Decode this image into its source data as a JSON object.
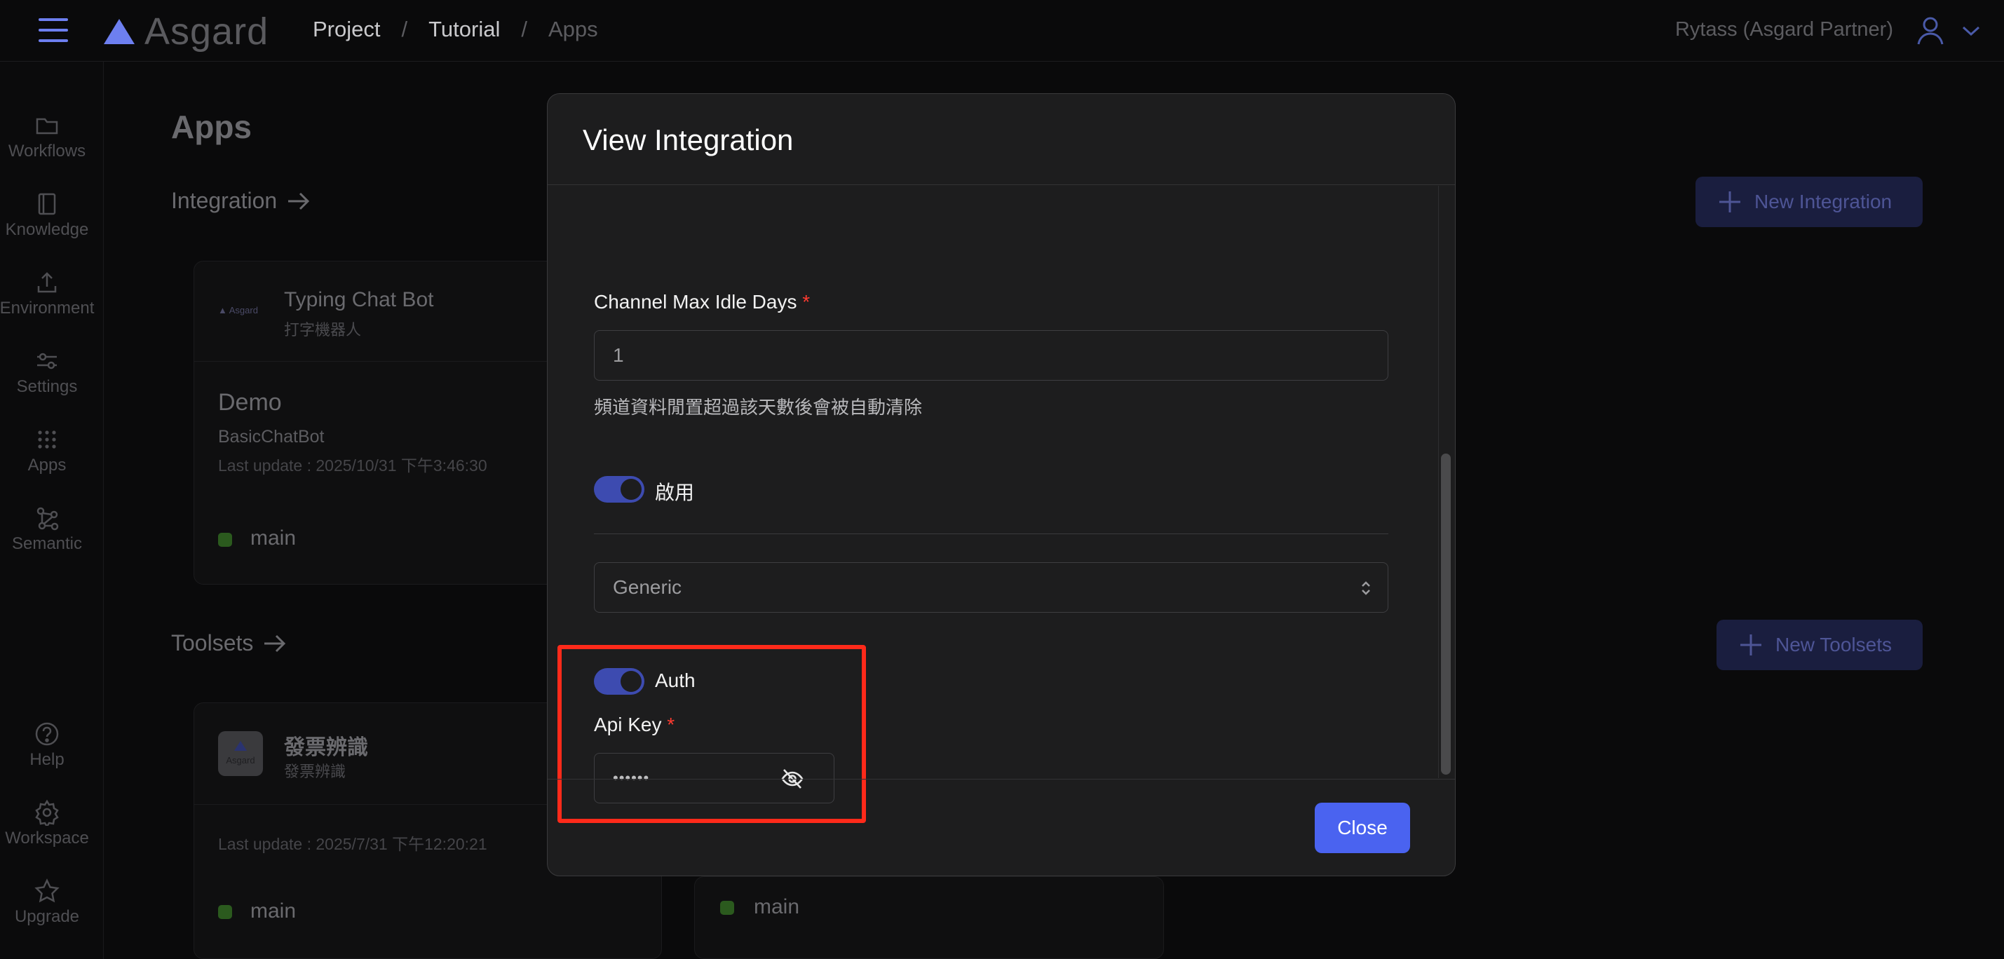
{
  "topbar": {
    "brand": "Asgard",
    "breadcrumb": [
      "Project",
      "Tutorial",
      "Apps"
    ],
    "org": "Rytass (Asgard Partner)"
  },
  "sidebar": {
    "items": [
      {
        "label": "Workflows",
        "icon": "folder-icon"
      },
      {
        "label": "Knowledge",
        "icon": "book-icon"
      },
      {
        "label": "Environment",
        "icon": "upload-icon"
      },
      {
        "label": "Settings",
        "icon": "sliders-icon"
      },
      {
        "label": "Apps",
        "icon": "grid-icon"
      },
      {
        "label": "Semantic",
        "icon": "graph-icon"
      }
    ],
    "bottom": [
      {
        "label": "Help",
        "icon": "help-icon"
      },
      {
        "label": "Workspace",
        "icon": "gear-icon"
      },
      {
        "label": "Upgrade",
        "icon": "star-icon"
      }
    ]
  },
  "page": {
    "title": "Apps",
    "integration": {
      "heading": "Integration",
      "new_button": "New Integration",
      "card": {
        "logo_text": "Asgard",
        "name": "Typing Chat Bot",
        "subtitle": "打字機器人",
        "env_name": "Demo",
        "bot_type": "BasicChatBot",
        "last_update": "Last update : 2025/10/31 下午3:46:30",
        "branch": "main"
      }
    },
    "toolsets": {
      "heading": "Toolsets",
      "new_button": "New Toolsets",
      "card": {
        "logo_text": "Asgard",
        "name": "發票辨識",
        "subtitle": "發票辨識",
        "last_update": "Last update : 2025/7/31 下午12:20:21",
        "branch": "main"
      },
      "card2": {
        "branch": "main"
      }
    }
  },
  "modal": {
    "title": "View Integration",
    "fields": {
      "idle_days_label": "Channel Max Idle Days",
      "required_mark": "*",
      "idle_days_value": "1",
      "idle_days_hint": "頻道資料閒置超過該天數後會被自動清除",
      "enable_label": "啟用",
      "enable_on": true,
      "type_value": "Generic",
      "auth_label": "Auth",
      "auth_on": true,
      "api_key_label": "Api Key",
      "api_key_masked": "••••••"
    },
    "close_button": "Close"
  },
  "colors": {
    "accent": "#4a63f0",
    "toggle_on": "#3d4bb0",
    "highlight": "#ff2a1a",
    "required": "#ff3b30"
  }
}
